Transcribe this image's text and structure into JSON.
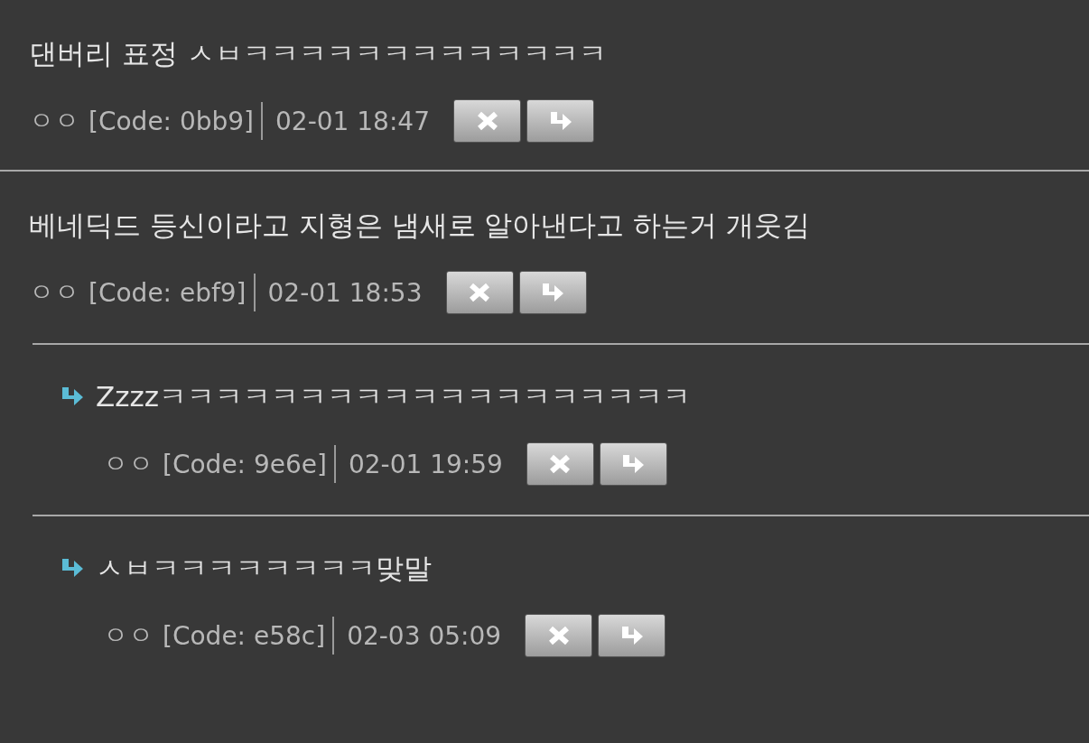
{
  "comments": [
    {
      "text": "댄버리 표정 ㅅㅂㅋㅋㅋㅋㅋㅋㅋㅋㅋㅋㅋㅋㅋ",
      "author": "ㅇㅇ",
      "code": "[Code: 0bb9]",
      "time": "02-01 18:47"
    },
    {
      "text": "베네딕드 등신이라고 지형은 냄새로 알아낸다고 하는거 개웃김",
      "author": "ㅇㅇ",
      "code": "[Code: ebf9]",
      "time": "02-01 18:53",
      "replies": [
        {
          "text": "Zzzzㅋㅋㅋㅋㅋㅋㅋㅋㅋㅋㅋㅋㅋㅋㅋㅋㅋㅋㅋ",
          "author": "ㅇㅇ",
          "code": "[Code: 9e6e]",
          "time": "02-01 19:59"
        },
        {
          "text": "ㅅㅂㅋㅋㅋㅋㅋㅋㅋㅋ맞말",
          "author": "ㅇㅇ",
          "code": "[Code: e58c]",
          "time": "02-03 05:09"
        }
      ]
    }
  ]
}
